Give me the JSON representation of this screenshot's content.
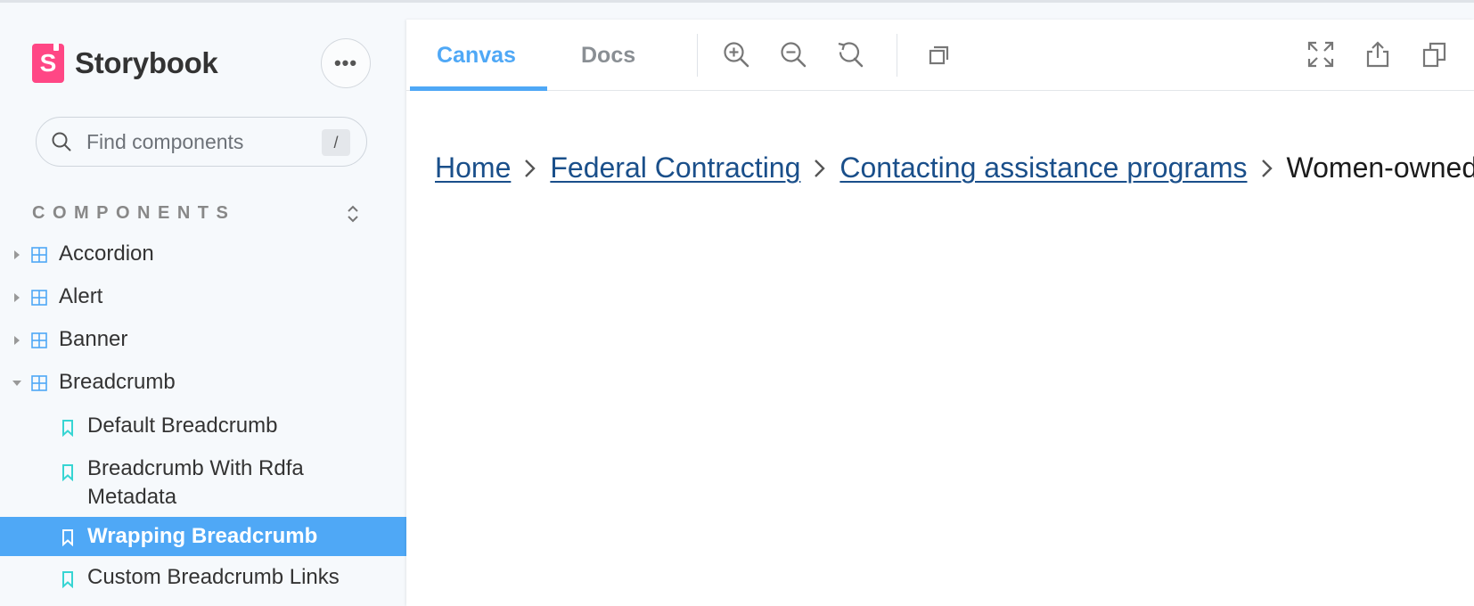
{
  "brand": {
    "name": "Storybook",
    "logo_letter": "S",
    "accent": "#ff4785"
  },
  "sidebar": {
    "menu_label": "•••",
    "search": {
      "placeholder": "Find components",
      "shortcut": "/"
    },
    "section_title": "COMPONENTS",
    "components": [
      {
        "label": "Accordion",
        "expanded": false
      },
      {
        "label": "Alert",
        "expanded": false
      },
      {
        "label": "Banner",
        "expanded": false
      },
      {
        "label": "Breadcrumb",
        "expanded": true
      }
    ],
    "stories": [
      {
        "label": "Default Breadcrumb",
        "selected": false
      },
      {
        "label": "Breadcrumb With Rdfa Metadata",
        "selected": false
      },
      {
        "label": "Wrapping Breadcrumb",
        "selected": true
      },
      {
        "label": "Custom Breadcrumb Links",
        "selected": false
      }
    ],
    "selected_color": "#4fa8f6"
  },
  "toolbar": {
    "tabs": [
      {
        "label": "Canvas",
        "active": true
      },
      {
        "label": "Docs",
        "active": false
      }
    ],
    "icons": [
      "zoom-in-icon",
      "zoom-out-icon",
      "reset-zoom-icon",
      "outline-icon",
      "fullscreen-icon",
      "share-icon",
      "copy-link-icon"
    ]
  },
  "preview": {
    "breadcrumb": {
      "links": [
        "Home",
        "Federal Contracting",
        "Contacting assistance programs"
      ],
      "current": "Women-owned"
    },
    "link_color": "#1a4f8a"
  }
}
